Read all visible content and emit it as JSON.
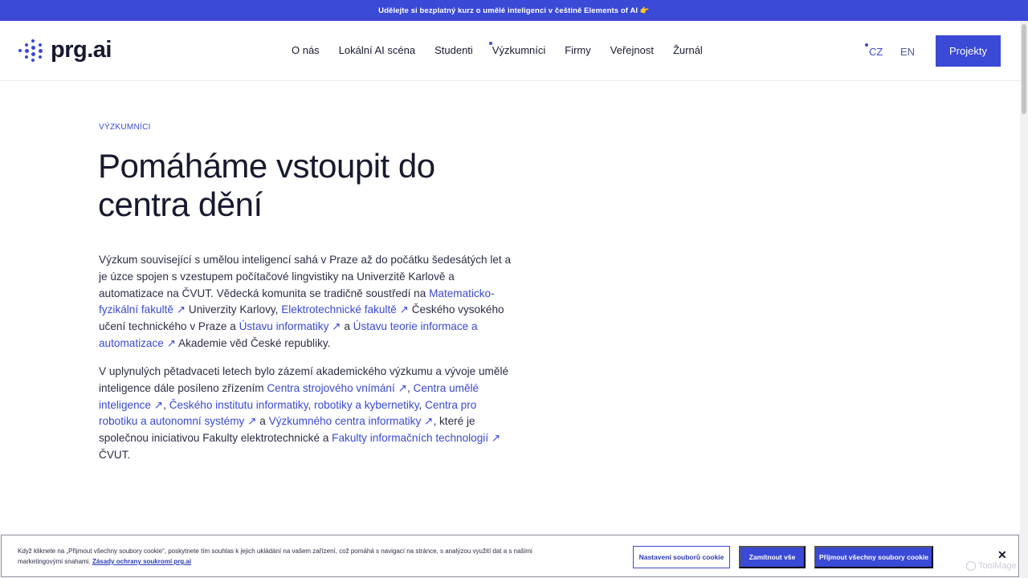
{
  "promo": {
    "text": "Udělejte si bezplatný kurz o umělé inteligenci v češtině Elements of AI 👉"
  },
  "header": {
    "logo_text": "prg.ai",
    "nav": [
      {
        "label": "O nás",
        "active": false
      },
      {
        "label": "Lokální AI scéna",
        "active": false
      },
      {
        "label": "Studenti",
        "active": false
      },
      {
        "label": "Výzkumníci",
        "active": true
      },
      {
        "label": "Firmy",
        "active": false
      },
      {
        "label": "Veřejnost",
        "active": false
      },
      {
        "label": "Žurnál",
        "active": false
      }
    ],
    "lang": {
      "cz": "CZ",
      "en": "EN"
    },
    "cta_label": "Projekty"
  },
  "main": {
    "kicker": "VÝZKUMNÍCI",
    "title": "Pomáháme vstoupit do centra dění",
    "p1": {
      "t1": "Výzkum související s umělou inteligencí sahá v Praze až do počátku šedesátých let a je úzce spojen s vzestupem počítačové lingvistiky na Univerzitě Karlově a automatizace na ČVUT. Vědecká komunita se tradičně soustředí na ",
      "l1": "Matematicko-fyzikální fakultě ↗",
      "t2": " Univerzity Karlovy, ",
      "l2": "Elektrotechnické fakultě ↗",
      "t3": " Českého vysokého učení technického v Praze a ",
      "l3": "Ústavu informatiky ↗",
      "t4": " a ",
      "l4": "Ústavu teorie informace a automatizace ↗",
      "t5": " Akademie věd České republiky."
    },
    "p2": {
      "t1": "V uplynulých pětadvaceti letech bylo zázemí akademického výzkumu a vývoje umělé inteligence dále posíleno zřízením ",
      "l1": "Centra strojového vnímání ↗",
      "t2": ", ",
      "l2": "Centra umělé inteligence ↗",
      "t3": ", ",
      "l3": "Českého institutu informatiky, robotiky a kybernetiky",
      "t4": ", ",
      "l4": "Centra pro robotiku a autonomní systémy ↗",
      "t5": " a ",
      "l5": "Výzkumného centra informatiky ↗",
      "t6": ", které je společnou iniciativou Fakulty elektrotechnické a ",
      "l6": "Fakulty informačních technologií ↗",
      "t7": " ČVUT."
    }
  },
  "cookie": {
    "text": "Když kliknete na „Přijmout všechny soubory cookie“, poskytnete tím souhlas k jejich ukládání na vašem zařízení, což pomáhá s navigací na stránce, s analýzou využití dat a s našimi marketingovými snahami.",
    "privacy_link": "Zásady ochrany soukromí prg.ai",
    "settings_label": "Nastavení souborů cookie",
    "reject_label": "Zamítnout vše",
    "accept_label": "Přijmout všechny soubory cookie",
    "close_icon": "close-icon"
  },
  "watermark": {
    "text": "ToolMage"
  },
  "colors": {
    "accent": "#3a49d6",
    "text": "#17192e"
  }
}
